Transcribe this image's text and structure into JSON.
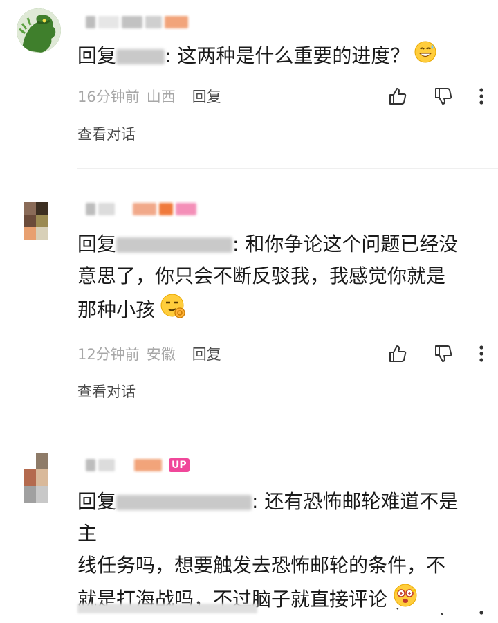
{
  "comments": [
    {
      "reply_prefix": "回复",
      "text": ": 这两种是什么重要的进度？",
      "time": "16分钟前",
      "region": "山西",
      "reply_label": "回复",
      "view_label": "查看对话"
    },
    {
      "reply_prefix": "回复",
      "text_line1": ": 和你争论这个问题已经没",
      "text_line2": "意思了，你只会不断反驳我，我感觉你就是",
      "text_line3": "那种小孩",
      "time": "12分钟前",
      "region": "安徽",
      "reply_label": "回复",
      "view_label": "查看对话"
    },
    {
      "badge": "UP",
      "reply_prefix": "回复",
      "text_line1": ": 还有恐怖邮轮难道不是主",
      "text_line2": "线任务吗，想要触发去恐怖邮轮的条件，不",
      "text_line3": "就是打海战吗，不过脑子就直接评论"
    }
  ],
  "colors": {
    "meta_gray": "#a7a7a7",
    "up_badge": "#f0479a",
    "text": "#1a1a1a"
  }
}
